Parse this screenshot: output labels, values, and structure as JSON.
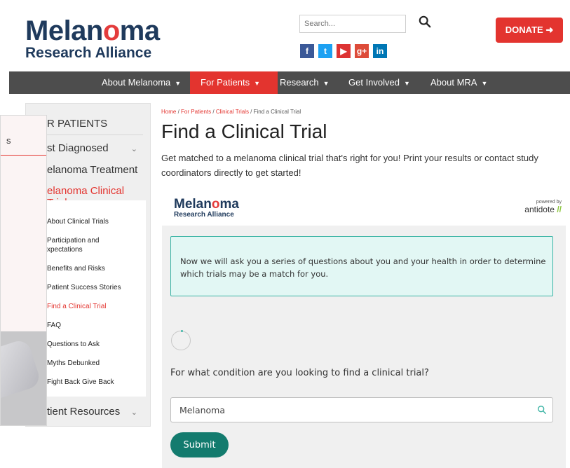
{
  "header": {
    "logo_main_1": "Melan",
    "logo_main_o": "o",
    "logo_main_2": "ma",
    "logo_sub": "Research Alliance",
    "search_placeholder": "Search...",
    "donate_label": "DONATE ➜",
    "social": [
      {
        "name": "facebook",
        "glyph": "f"
      },
      {
        "name": "twitter",
        "glyph": "t"
      },
      {
        "name": "youtube",
        "glyph": "▶"
      },
      {
        "name": "google-plus",
        "glyph": "g+"
      },
      {
        "name": "linkedin",
        "glyph": "in"
      }
    ]
  },
  "nav": {
    "items": [
      {
        "label": "About Melanoma"
      },
      {
        "label": "For Patients"
      },
      {
        "label": "Research"
      },
      {
        "label": "Get Involved"
      },
      {
        "label": "About MRA"
      }
    ],
    "active": "For Patients"
  },
  "sidebar": {
    "title": "R PATIENTS",
    "items": [
      {
        "label": "st Diagnosed"
      },
      {
        "label": "elanoma Treatment"
      },
      {
        "label": "elanoma Clinical Trials"
      }
    ],
    "subitems": [
      {
        "label": "About Clinical Trials"
      },
      {
        "label": "Participation and Expectations",
        "l1": "Participation and",
        "l2": "xpectations"
      },
      {
        "label": "Benefits and Risks"
      },
      {
        "label": "Patient Success Stories"
      },
      {
        "label": "Find a Clinical Trial"
      },
      {
        "label": "FAQ"
      },
      {
        "label": "Questions to Ask"
      },
      {
        "label": "Myths Debunked"
      },
      {
        "label": "Fight Back Give Back"
      }
    ],
    "last_item": "tient Resources"
  },
  "overlay": {
    "text": "s"
  },
  "breadcrumb": {
    "home": "Home",
    "for_patients": "For Patients",
    "clinical_trials": "Clinical Trials",
    "current": "Find a Clinical Trial"
  },
  "page": {
    "title": "Find a Clinical Trial",
    "intro": "Get matched to a melanoma clinical trial that's right for you! Print your results or contact study coordinators directly to get started!"
  },
  "widget": {
    "powered_by": "powered by",
    "antidote": "antidote",
    "info_text": "Now we will ask you a series of questions about you and your health in order to determine which trials may be a match for you.",
    "question": "For what condition are you looking to find a clinical trial?",
    "condition_value": "Melanoma",
    "submit_label": "Submit"
  },
  "colors": {
    "brand_navy": "#1f3a5c",
    "brand_red": "#e3342f",
    "teal": "#137b6e",
    "nav_bg": "#4d4d4d"
  }
}
